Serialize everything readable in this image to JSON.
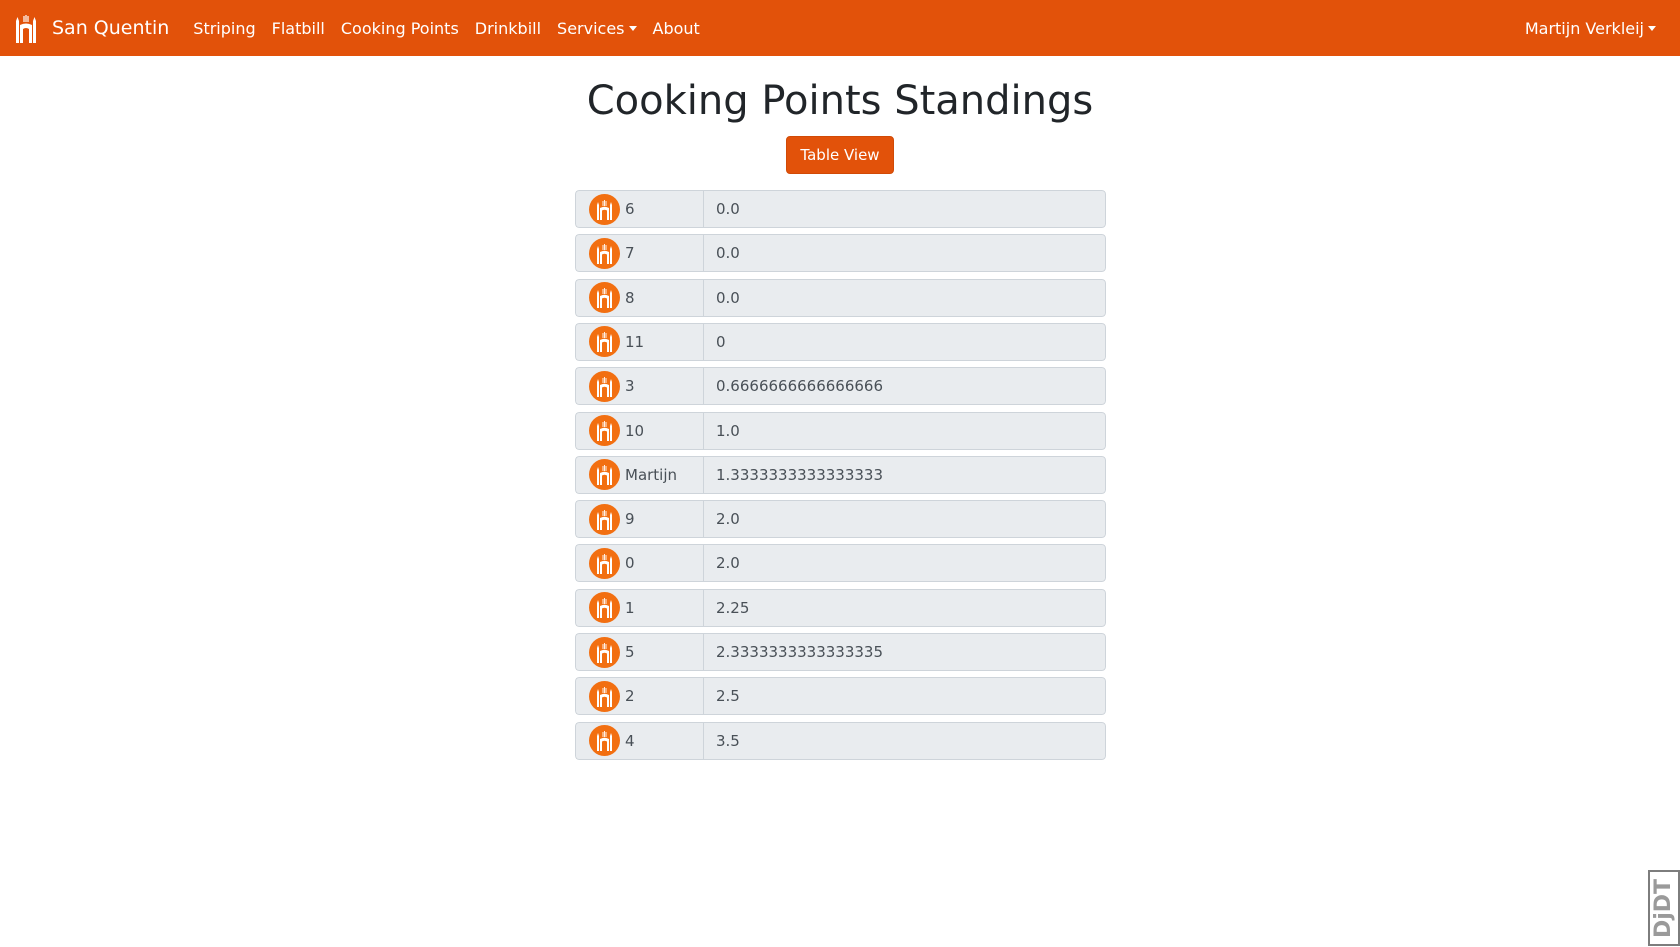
{
  "navbar": {
    "brand": "San Quentin",
    "links": [
      "Striping",
      "Flatbill",
      "Cooking Points",
      "Drinkbill"
    ],
    "services_label": "Services",
    "about_label": "About",
    "user_label": "Martijn Verkleij",
    "background_color": "#e2520a",
    "logo_icon": "building-gate-icon"
  },
  "main": {
    "title": "Cooking Points Standings",
    "table_view_label": "Table View"
  },
  "standings": [
    {
      "name": "6",
      "points": "0.0"
    },
    {
      "name": "7",
      "points": "0.0"
    },
    {
      "name": "8",
      "points": "0.0"
    },
    {
      "name": "11",
      "points": "0"
    },
    {
      "name": "3",
      "points": "0.6666666666666666"
    },
    {
      "name": "10",
      "points": "1.0"
    },
    {
      "name": "Martijn",
      "points": "1.3333333333333333"
    },
    {
      "name": "9",
      "points": "2.0"
    },
    {
      "name": "0",
      "points": "2.0"
    },
    {
      "name": "1",
      "points": "2.25"
    },
    {
      "name": "5",
      "points": "2.3333333333333335"
    },
    {
      "name": "2",
      "points": "2.5"
    },
    {
      "name": "4",
      "points": "3.5"
    }
  ],
  "avatar": {
    "color": "#f26f11",
    "icon": "building-gate-icon"
  },
  "debug_toolbar": {
    "label": "DjDT"
  }
}
